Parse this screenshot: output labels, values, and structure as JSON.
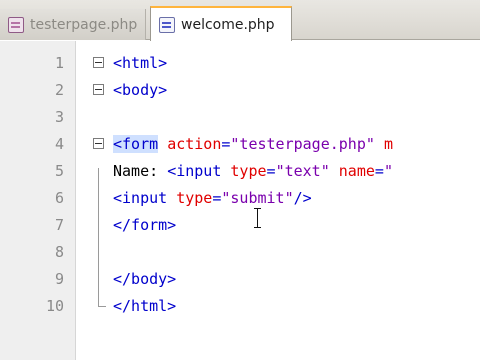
{
  "tabs": [
    {
      "label": "testerpage.php",
      "active": false,
      "icon": "php-file-icon"
    },
    {
      "label": "welcome.php",
      "active": true,
      "icon": "php-file-icon"
    }
  ],
  "colors": {
    "tag": "#0000cc",
    "attribute": "#e00000",
    "value": "#7a00ad",
    "active_tab_accent": "#ffb43c"
  },
  "editor": {
    "line_numbers": [
      "1",
      "2",
      "3",
      "4",
      "5",
      "6",
      "7",
      "8",
      "9",
      "10"
    ],
    "lines": {
      "l1": "<html>",
      "l2": "<body>",
      "l4_tag": "<form",
      "l4_attr1": "action",
      "l4_eq1": "=",
      "l4_val1": "\"testerpage.php\"",
      "l4_attr2": "m",
      "l5_text": "Name: ",
      "l5_tag": "<input",
      "l5_attr1": "type",
      "l5_eq1": "=",
      "l5_val1": "\"text\"",
      "l5_attr2": "name",
      "l5_eq2": "=",
      "l5_val2": "\"",
      "l6_tag": "<input",
      "l6_attr1": "type",
      "l6_eq1": "=",
      "l6_val1": "\"submit\"",
      "l6_close": "/>",
      "l7": "</form>",
      "l9": "</body>",
      "l10": "</html>"
    }
  }
}
